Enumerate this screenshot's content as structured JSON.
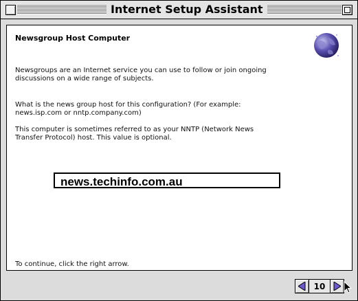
{
  "window": {
    "title": "Internet Setup Assistant"
  },
  "page": {
    "heading": "Newsgroup Host Computer",
    "paragraph1": "Newsgroups are an Internet service you can use to follow or join ongoing discussions on a wide range of subjects.",
    "paragraph2": "What is the news group host for this configuration? (For example: news.isp.com or nntp.company.com)",
    "paragraph3": "This computer is sometimes referred to as your NNTP (Network News Transfer Protocol) host. This value is optional.",
    "news_host_value": "news.techinfo.com.au",
    "continue_instruction": "To continue, click the right arrow."
  },
  "nav": {
    "page_number": "10",
    "icons": {
      "back": "left-triangle-arrow",
      "forward": "right-triangle-arrow"
    }
  },
  "colors": {
    "window_gray": "#dcdcdc",
    "arrow_fill": "#6a5acd"
  }
}
